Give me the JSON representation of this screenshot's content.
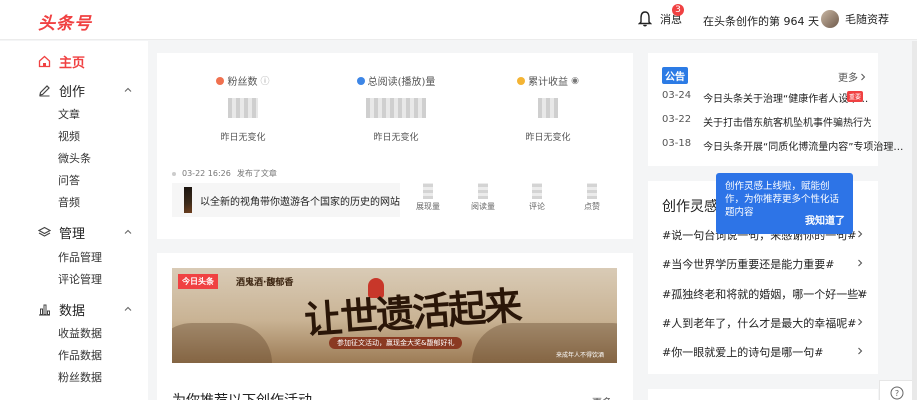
{
  "header": {
    "logo": "头条号",
    "message_label": "消息",
    "message_count": "3",
    "days_text": "在头条创作的第 964 天",
    "username": "毛随资荐"
  },
  "sidebar": {
    "home": "主页",
    "create": {
      "label": "创作",
      "items": [
        "文章",
        "视频",
        "微头条",
        "问答",
        "音频"
      ]
    },
    "manage": {
      "label": "管理",
      "items": [
        "作品管理",
        "评论管理"
      ]
    },
    "data": {
      "label": "数据",
      "items": [
        "收益数据",
        "作品数据",
        "粉丝数据"
      ]
    }
  },
  "stats": [
    {
      "label": "粉丝数",
      "change": "昨日无变化",
      "icon": "person-icon",
      "color": "#f0714f"
    },
    {
      "label": "总阅读(播放)量",
      "change": "昨日无变化",
      "icon": "eye-icon",
      "color": "#3d86e6"
    },
    {
      "label": "累计收益",
      "change": "昨日无变化",
      "icon": "coin-icon",
      "color": "#f4b434"
    }
  ],
  "article": {
    "date": "03-22 16:26",
    "status": "发布了文章",
    "title": "以全新的视角带你遨游各个国家的历史的网站",
    "metrics": [
      "展现量",
      "阅读量",
      "评论",
      "点赞"
    ]
  },
  "banner": {
    "brand1": "今日头条",
    "brand2": "酒鬼酒·馥郁香",
    "headline": "让世遗活起来",
    "sub": "参加征文活动，赢现金大奖&馥郁好礼",
    "note": "来成年人不得饮酒"
  },
  "activity": {
    "title": "为你推荐以下创作活动",
    "more": "更多"
  },
  "notice": {
    "tag": "公告",
    "more": "更多",
    "items": [
      {
        "date": "03-24",
        "text": "今日头条关于治理“健康作者人设不…"
      },
      {
        "date": "03-22",
        "text": "关于打击借东航客机坠机事件骗热行为…"
      },
      {
        "date": "03-18",
        "text": "今日头条开展“同质化博流量内容”专项治理…"
      }
    ],
    "hot_label": "重要"
  },
  "inspiration": {
    "title": "创作灵感",
    "topics": [
      "#说一句台词说一句，来感谢你的一句#",
      "#当今世界学历重要还是能力重要#",
      "#孤独终老和将就的婚姻，哪一个好一些#",
      "#人到老年了，什么才是最大的幸福呢#",
      "#你一眼就爱上的诗句是哪一句#"
    ]
  },
  "tooltip": {
    "text": "创作灵感上线啦，赋能创作，为你推荐更多个性化话题内容",
    "button": "我知道了"
  }
}
